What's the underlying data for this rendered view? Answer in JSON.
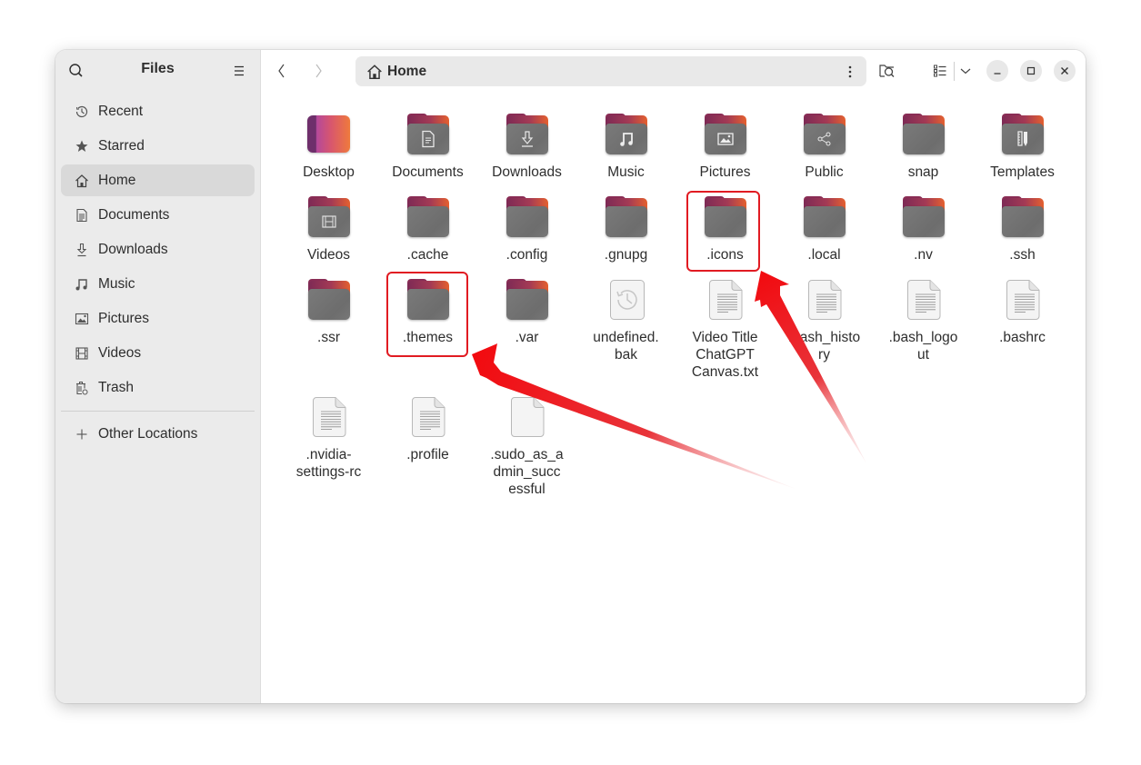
{
  "sidebar": {
    "title": "Files",
    "search_icon": "search-icon",
    "menu_icon": "hamburger-menu-icon",
    "items": [
      {
        "label": "Recent",
        "icon": "clock-icon",
        "active": false
      },
      {
        "label": "Starred",
        "icon": "star-icon",
        "active": false
      },
      {
        "label": "Home",
        "icon": "home-icon",
        "active": true
      },
      {
        "label": "Documents",
        "icon": "document-icon",
        "active": false
      },
      {
        "label": "Downloads",
        "icon": "download-icon",
        "active": false
      },
      {
        "label": "Music",
        "icon": "music-note-icon",
        "active": false
      },
      {
        "label": "Pictures",
        "icon": "picture-icon",
        "active": false
      },
      {
        "label": "Videos",
        "icon": "film-icon",
        "active": false
      },
      {
        "label": "Trash",
        "icon": "trash-icon",
        "active": false
      }
    ],
    "other_locations": {
      "label": "Other Locations",
      "icon": "plus-icon"
    }
  },
  "toolbar": {
    "back_icon": "chevron-left-icon",
    "forward_icon": "chevron-right-icon",
    "path": {
      "icon": "home-icon",
      "label": "Home"
    },
    "path_menu_icon": "vertical-ellipsis-icon",
    "search_location_icon": "folder-search-icon",
    "view_list_icon": "list-view-icon",
    "view_options_icon": "chevron-down-icon",
    "minimize_icon": "minimize-icon",
    "maximize_icon": "maximize-icon",
    "close_icon": "close-icon"
  },
  "files": [
    {
      "name": "Desktop",
      "type": "desktop"
    },
    {
      "name": "Documents",
      "type": "folder",
      "glyph": "document"
    },
    {
      "name": "Downloads",
      "type": "folder",
      "glyph": "download"
    },
    {
      "name": "Music",
      "type": "folder",
      "glyph": "music"
    },
    {
      "name": "Pictures",
      "type": "folder",
      "glyph": "picture"
    },
    {
      "name": "Public",
      "type": "folder",
      "glyph": "share"
    },
    {
      "name": "snap",
      "type": "folder",
      "glyph": ""
    },
    {
      "name": "Templates",
      "type": "folder",
      "glyph": "template"
    },
    {
      "name": "Videos",
      "type": "folder",
      "glyph": "film"
    },
    {
      "name": ".cache",
      "type": "folder",
      "glyph": ""
    },
    {
      "name": ".config",
      "type": "folder",
      "glyph": ""
    },
    {
      "name": ".gnupg",
      "type": "folder",
      "glyph": ""
    },
    {
      "name": ".icons",
      "type": "folder",
      "glyph": "",
      "highlighted": true
    },
    {
      "name": ".local",
      "type": "folder",
      "glyph": ""
    },
    {
      "name": ".nv",
      "type": "folder",
      "glyph": ""
    },
    {
      "name": ".ssh",
      "type": "folder",
      "glyph": ""
    },
    {
      "name": ".ssr",
      "type": "folder",
      "glyph": ""
    },
    {
      "name": ".themes",
      "type": "folder",
      "glyph": "",
      "highlighted": true
    },
    {
      "name": ".var",
      "type": "folder",
      "glyph": ""
    },
    {
      "name": "undefined.bak",
      "display": "undefined.\nbak",
      "type": "backup"
    },
    {
      "name": "Video Title ChatGPT Canvas.txt",
      "display": "Video Title\nChatGPT\nCanvas.txt",
      "type": "text"
    },
    {
      "name": ".bash_history",
      "display": ".bash_histo\nry",
      "type": "text"
    },
    {
      "name": ".bash_logout",
      "display": ".bash_logo\nut",
      "type": "text"
    },
    {
      "name": ".bashrc",
      "type": "text"
    },
    {
      "name": ".nvidia-settings-rc",
      "display": ".nvidia-\nsettings-rc",
      "type": "text"
    },
    {
      "name": ".profile",
      "type": "text"
    },
    {
      "name": ".sudo_as_admin_successful",
      "display": ".sudo_as_a\ndmin_succ\nessful",
      "type": "empty"
    }
  ],
  "annotations": {
    "highlight_color": "#e11b22",
    "arrow_color": "#e8141c",
    "targets": [
      ".icons",
      ".themes"
    ]
  },
  "colors": {
    "sidebar_bg": "#ebebeb",
    "active_item_bg": "#d9d9d9",
    "folder_gray": "#727272",
    "folder_accent_start": "#7d2a55",
    "folder_accent_end": "#e4602f"
  }
}
